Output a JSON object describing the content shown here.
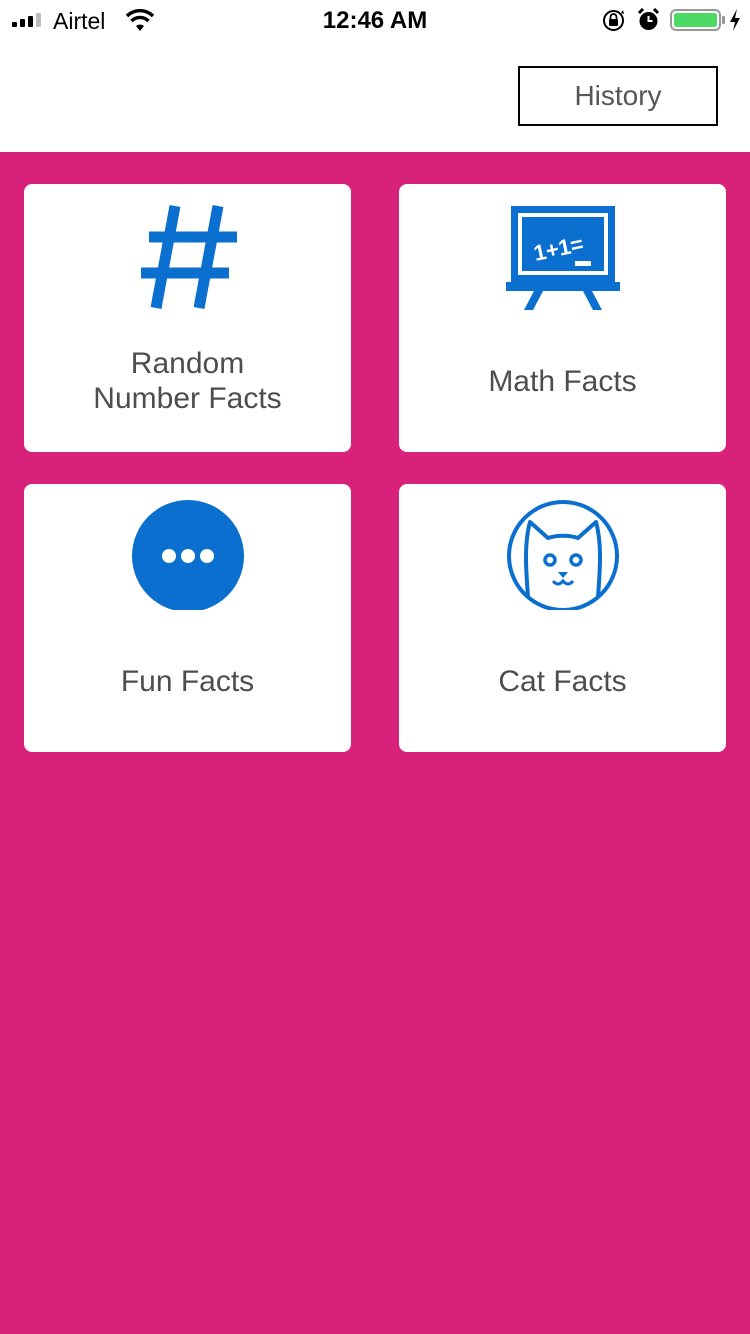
{
  "status_bar": {
    "carrier": "Airtel",
    "time": "12:46 AM",
    "icons": [
      "signal-icon",
      "wifi-icon",
      "rotation-lock-icon",
      "alarm-icon",
      "battery-icon",
      "charging-icon"
    ]
  },
  "header": {
    "history_label": "History"
  },
  "colors": {
    "background": "#d8217a",
    "icon": "#0a6fce",
    "card": "#ffffff",
    "label": "#4d4d4d"
  },
  "cards": [
    {
      "label_line1": "Random",
      "label_line2": "Number Facts",
      "icon": "hashtag-icon"
    },
    {
      "label": "Math Facts",
      "icon": "chalkboard-icon",
      "board_text": "1+1="
    },
    {
      "label": "Fun Facts",
      "icon": "more-dots-icon"
    },
    {
      "label": "Cat Facts",
      "icon": "cat-icon"
    }
  ]
}
